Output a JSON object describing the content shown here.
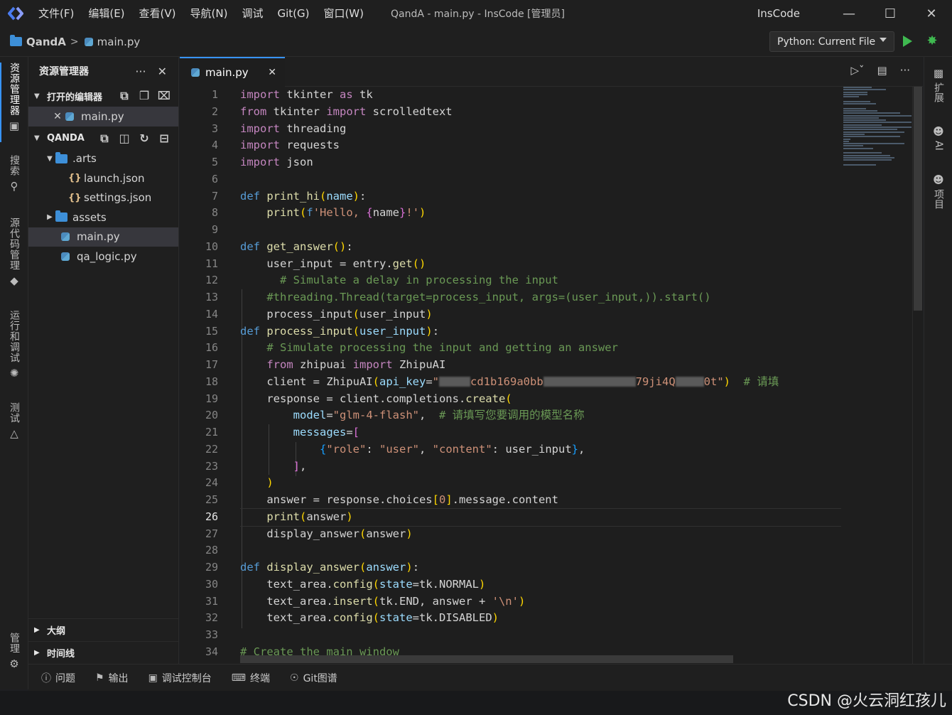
{
  "menu": [
    "文件(F)",
    "编辑(E)",
    "查看(V)",
    "导航(N)",
    "调试",
    "Git(G)",
    "窗口(W)"
  ],
  "window_title": "QandA - main.py - InsCode [管理员]",
  "brand": "InsCode",
  "breadcrumb": {
    "project": "QandA",
    "file": "main.py"
  },
  "run_config": "Python: Current File",
  "activity": [
    {
      "label": "资源管理器",
      "icon": "file-explorer-icon"
    },
    {
      "label": "搜索",
      "icon": "search-icon"
    },
    {
      "label": "源代码管理",
      "icon": "source-control-icon"
    },
    {
      "label": "运行和调试",
      "icon": "debug-icon"
    },
    {
      "label": "测试",
      "icon": "flask-icon"
    },
    {
      "label": "管理",
      "icon": "gear-icon"
    }
  ],
  "sidebar": {
    "title": "资源管理器",
    "open_editors_label": "打开的编辑器",
    "open_editor_file": "main.py",
    "project_label": "QANDA",
    "tree": {
      "arts": ".arts",
      "launch": "launch.json",
      "settings": "settings.json",
      "assets": "assets",
      "main": "main.py",
      "qa_logic": "qa_logic.py"
    },
    "outline_label": "大纲",
    "timeline_label": "时间线"
  },
  "editor": {
    "tab": "main.py",
    "current_line": 26,
    "line_numbers": [
      "1",
      "2",
      "3",
      "4",
      "5",
      "6",
      "7",
      "8",
      "9",
      "10",
      "11",
      "12",
      "13",
      "14",
      "15",
      "16",
      "17",
      "18",
      "19",
      "20",
      "21",
      "22",
      "23",
      "24",
      "25",
      "26",
      "27",
      "28",
      "29",
      "30",
      "31",
      "32",
      "33",
      "34"
    ],
    "code_text": {
      "l1": "import tkinter as tk",
      "l2": "from tkinter import scrolledtext",
      "l3": "import threading",
      "l4": "import requests",
      "l5": "import json",
      "l7": "def print_hi(name):",
      "l8": "print(f'Hello, {name}!')",
      "l10": "def get_answer():",
      "l11": "user_input = entry.get()",
      "l12": "# Simulate a delay in processing the input",
      "l13": "#threading.Thread(target=process_input, args=(user_input,)).start()",
      "l14": "process_input(user_input)",
      "l15": "def process_input(user_input):",
      "l16": "# Simulate processing the input and getting an answer",
      "l17": "from zhipuai import ZhipuAI",
      "l18_a": "client = ZhipuAI(api_key=\"",
      "l18_b": "cd1b169a0bb",
      "l18_c": "79ji4Q",
      "l18_d": "0t\")  # 请填",
      "l19": "response = client.completions.create(",
      "l20": "model=\"glm-4-flash\",  # 请填写您要调用的模型名称",
      "l21": "messages=[",
      "l22": "{\"role\": \"user\", \"content\": user_input},",
      "l23": "],",
      "l24": ")",
      "l25": "answer = response.choices[0].message.content",
      "l26": "print(answer)",
      "l27": "display_answer(answer)",
      "l29": "def display_answer(answer):",
      "l30": "text_area.config(state=tk.NORMAL)",
      "l31": "text_area.insert(tk.END, answer + '\\n')",
      "l32": "text_area.config(state=tk.DISABLED)",
      "l34": "# Create the main window"
    }
  },
  "right_bar": [
    {
      "label": "扩展",
      "icon": "puzzle-icon"
    },
    {
      "label": "AI",
      "icon": "ai-icon"
    },
    {
      "label": "项目",
      "icon": "project-icon"
    }
  ],
  "panel_tabs": [
    {
      "label": "问题",
      "icon": "info-icon"
    },
    {
      "label": "输出",
      "icon": "flag-icon"
    },
    {
      "label": "调试控制台",
      "icon": "debug-console-icon"
    },
    {
      "label": "终端",
      "icon": "terminal-icon"
    },
    {
      "label": "Git图谱",
      "icon": "git-graph-icon"
    }
  ],
  "watermark": "CSDN @火云洞红孩儿"
}
